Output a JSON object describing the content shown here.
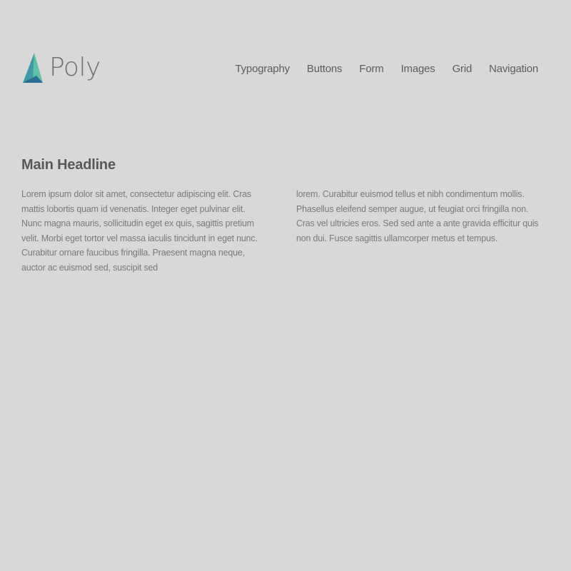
{
  "brand": {
    "name": "Poly",
    "logo_icon": "triangle-logo-icon",
    "colors": {
      "logo_teal": "#4aa7a3",
      "logo_blue": "#2d6f95",
      "logo_green": "#6cc6a6"
    }
  },
  "nav": {
    "items": [
      {
        "label": "Typography"
      },
      {
        "label": "Buttons"
      },
      {
        "label": "Form"
      },
      {
        "label": "Images"
      },
      {
        "label": "Grid"
      },
      {
        "label": "Navigation"
      }
    ]
  },
  "main": {
    "headline": "Main Headline",
    "column_left": "Lorem ipsum dolor sit amet, consectetur adipiscing elit. Cras mattis lobortis quam id venenatis. Integer eget pulvinar elit. Nunc magna mauris, sollicitudin eget ex quis, sagittis pretium velit. Morbi eget tortor vel massa iaculis tincidunt in eget nunc. Curabitur ornare faucibus fringilla. Praesent magna neque, auctor ac euismod sed, suscipit sed",
    "column_right": "lorem. Curabitur euismod tellus et nibh condimentum mollis. Phasellus eleifend semper augue, ut feugiat orci fringilla non. Cras vel ultricies eros. Sed sed ante a ante gravida efficitur quis non dui. Fusce sagittis ullamcorper metus et tempus."
  },
  "theme": {
    "background": "#d8d8d8",
    "text": "#6c6c6c",
    "headline": "#585858"
  }
}
